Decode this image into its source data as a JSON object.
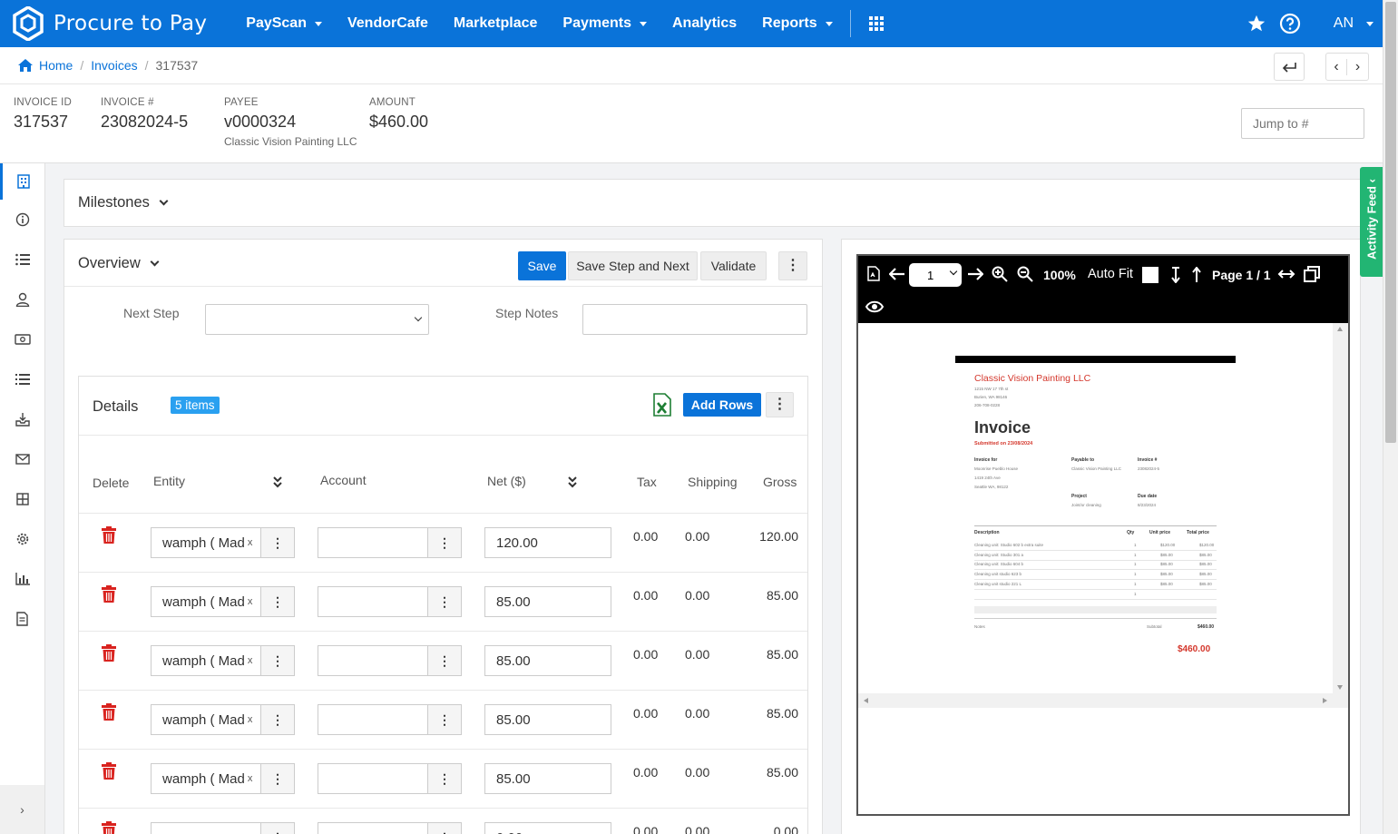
{
  "app": {
    "title": "Procure to Pay",
    "brand_color": "#0a73d9",
    "user_initials": "AN"
  },
  "nav": {
    "items": [
      {
        "label": "PayScan",
        "dropdown": true
      },
      {
        "label": "VendorCafe",
        "dropdown": false
      },
      {
        "label": "Marketplace",
        "dropdown": false
      },
      {
        "label": "Payments",
        "dropdown": true
      },
      {
        "label": "Analytics",
        "dropdown": false
      },
      {
        "label": "Reports",
        "dropdown": true
      }
    ]
  },
  "breadcrumb": {
    "home": "Home",
    "invoices": "Invoices",
    "current": "317537"
  },
  "invoice": {
    "id_label": "INVOICE ID",
    "id": "317537",
    "number_label": "INVOICE #",
    "number": "23082024-5",
    "payee_label": "PAYEE",
    "payee": "v0000324",
    "payee_name": "Classic Vision Painting LLC",
    "amount_label": "AMOUNT",
    "amount": "$460.00"
  },
  "jump": {
    "placeholder": "Jump to #"
  },
  "milestones": {
    "label": "Milestones"
  },
  "overview": {
    "label": "Overview",
    "save": "Save",
    "save_next": "Save Step and Next",
    "validate": "Validate",
    "next_step_label": "Next Step",
    "next_step_value": "",
    "step_notes_label": "Step Notes",
    "step_notes_value": ""
  },
  "details": {
    "title": "Details",
    "badge": "5 items",
    "add_rows": "Add Rows",
    "columns": [
      "Delete",
      "Entity",
      "Account",
      "Net ($)",
      "Tax",
      "Shipping",
      "Gross"
    ],
    "rows": [
      {
        "entity": "wamph ( Mad",
        "account": "",
        "net": "120.00",
        "tax": "0.00",
        "shipping": "0.00",
        "gross": "120.00"
      },
      {
        "entity": "wamph ( Mad",
        "account": "",
        "net": "85.00",
        "tax": "0.00",
        "shipping": "0.00",
        "gross": "85.00"
      },
      {
        "entity": "wamph ( Mad",
        "account": "",
        "net": "85.00",
        "tax": "0.00",
        "shipping": "0.00",
        "gross": "85.00"
      },
      {
        "entity": "wamph ( Mad",
        "account": "",
        "net": "85.00",
        "tax": "0.00",
        "shipping": "0.00",
        "gross": "85.00"
      },
      {
        "entity": "wamph ( Mad",
        "account": "",
        "net": "85.00",
        "tax": "0.00",
        "shipping": "0.00",
        "gross": "85.00"
      },
      {
        "entity": "",
        "account": "",
        "net": "0.00",
        "tax": "0.00",
        "shipping": "0.00",
        "gross": "0.00"
      }
    ]
  },
  "viewer": {
    "page_value": "1",
    "zoom": "100%",
    "auto_fit": "Auto Fit",
    "page_info": "Page 1 / 1"
  },
  "doc": {
    "company": "Classic Vision Painting LLC",
    "company_addr": [
      "1215 NW 17 7th st",
      "Burien, WA 98146",
      "206-708-0228"
    ],
    "title": "Invoice",
    "submitted": "Submitted on 23/08/2024",
    "invoice_for_label": "Invoice for",
    "invoice_for": [
      "Moonrise Pueblo House",
      "1419 24th Ave",
      "Seattle WA, 98122"
    ],
    "payable_label": "Payable to",
    "payable": "Classic Vision Painting LLC",
    "inv_no_label": "Invoice #",
    "inv_no": "23082024-5",
    "project_label": "Project",
    "project": "Joint/or cleaning",
    "due_label": "Due date",
    "due": "8/23/2024",
    "table_headers": [
      "Description",
      "Qty",
      "Unit price",
      "Total price"
    ],
    "lines": [
      {
        "desc": "Cleaning unit: Studio 602 b extra suite",
        "qty": "1",
        "unit": "$120.00",
        "total": "$120.00"
      },
      {
        "desc": "Cleaning unit: Studio 301 a",
        "qty": "1",
        "unit": "$85.00",
        "total": "$85.00"
      },
      {
        "desc": "Cleaning unit: Studio 604 b",
        "qty": "1",
        "unit": "$85.00",
        "total": "$85.00"
      },
      {
        "desc": "Cleaning unit studio 623 b",
        "qty": "1",
        "unit": "$85.00",
        "total": "$85.00"
      },
      {
        "desc": "Cleaning unit studio 221 L",
        "qty": "1",
        "unit": "$85.00",
        "total": "$85.00"
      },
      {
        "desc": "",
        "qty": "1",
        "unit": "",
        "total": ""
      }
    ],
    "notes_label": "Notes",
    "subtotal_label": "Subtotal",
    "subtotal": "$460.00",
    "total": "$460.00"
  },
  "activity_feed": {
    "label": "Activity Feed"
  }
}
